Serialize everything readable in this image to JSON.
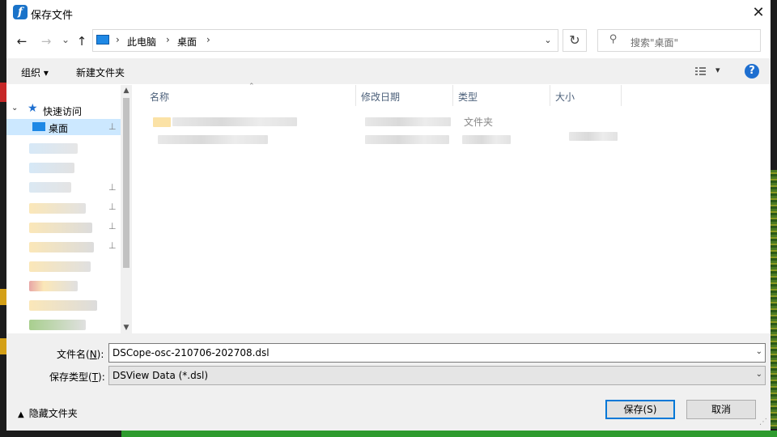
{
  "dialog": {
    "title": "保存文件",
    "close_symbol": "✕"
  },
  "nav": {
    "back": "←",
    "forward": "→",
    "recent": "⌄",
    "up": "↑"
  },
  "address": {
    "crumbs": [
      "此电脑",
      "桌面"
    ],
    "separator": "›",
    "dropdown": "⌄"
  },
  "refresh_symbol": "↻",
  "search": {
    "placeholder": "搜索\"桌面\""
  },
  "toolbar": {
    "organize": "组织 ▾",
    "new_folder": "新建文件夹",
    "view_dropdown": "▾",
    "help": "?"
  },
  "nav_pane": {
    "quick_access": "快速访问",
    "desktop": "桌面",
    "chevron": "⌄",
    "pin": "📌"
  },
  "columns": {
    "name": "名称",
    "date": "修改日期",
    "type": "类型",
    "size": "大小"
  },
  "file_rows": [
    {
      "type": "文件夹"
    }
  ],
  "filename": {
    "label": "文件名(",
    "hotkey": "N",
    "label_end": "):",
    "value": "DSCope-osc-210706-202708.dsl"
  },
  "filetype": {
    "label": "保存类型(",
    "hotkey": "T",
    "label_end": "):",
    "value": "DSView Data (*.dsl)"
  },
  "hide_folders": "隐藏文件夹",
  "buttons": {
    "save": "保存(S)",
    "cancel": "取消"
  },
  "colors": {
    "accent": "#0078d7",
    "selection": "#cce8ff",
    "toolbar_bg": "#f0f0f0"
  }
}
